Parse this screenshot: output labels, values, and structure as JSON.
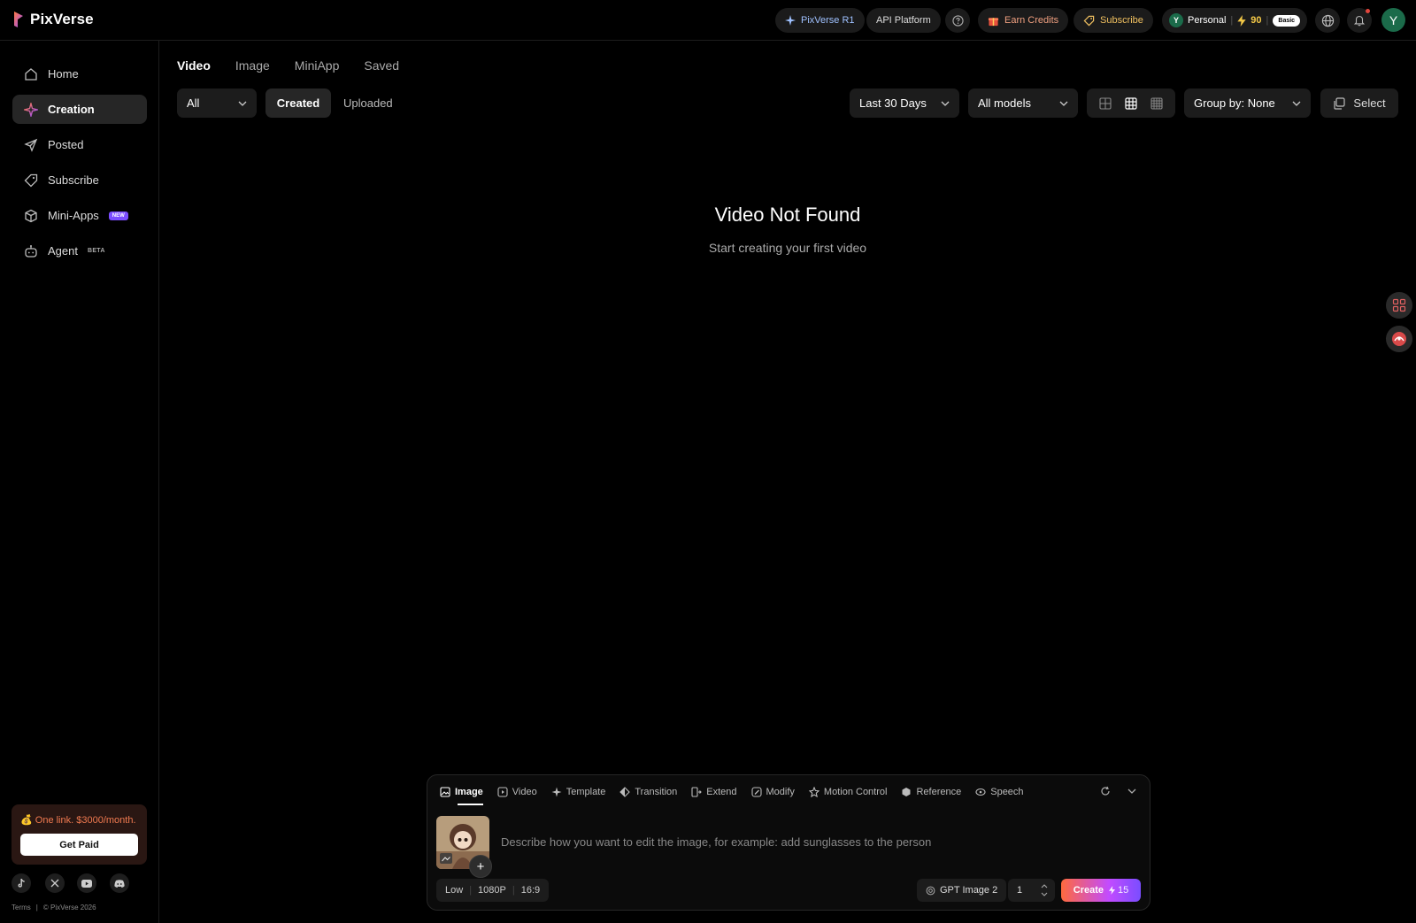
{
  "app": {
    "name": "PixVerse"
  },
  "topbar": {
    "r1_label": "PixVerse R1",
    "api_label": "API Platform",
    "earn_label": "Earn Credits",
    "subscribe_label": "Subscribe",
    "account_initial": "Y",
    "account_label": "Personal",
    "credits": "90",
    "plan": "Basic",
    "avatar_initial": "Y"
  },
  "sidebar": {
    "items": [
      {
        "label": "Home",
        "icon": "home-icon"
      },
      {
        "label": "Creation",
        "icon": "sparkle-icon",
        "active": true
      },
      {
        "label": "Posted",
        "icon": "send-icon"
      },
      {
        "label": "Subscribe",
        "icon": "tag-icon"
      },
      {
        "label": "Mini-Apps",
        "icon": "cube-icon",
        "badge": "NEW"
      },
      {
        "label": "Agent",
        "icon": "robot-icon",
        "badge": "BETA"
      }
    ],
    "promo_text": "One link. $3000/month.",
    "promo_button": "Get Paid",
    "footer_terms": "Terms",
    "footer_copyright": "© PixVerse 2026"
  },
  "content": {
    "tabs": [
      "Video",
      "Image",
      "MiniApp",
      "Saved"
    ],
    "active_tab": "Video",
    "filter_all": "All",
    "created_label": "Created",
    "uploaded_label": "Uploaded",
    "date_range": "Last 30 Days",
    "models": "All models",
    "group_by": "Group by: None",
    "select_label": "Select",
    "empty_title": "Video Not Found",
    "empty_subtitle": "Start creating your first video"
  },
  "composer": {
    "tabs": [
      "Image",
      "Video",
      "Template",
      "Transition",
      "Extend",
      "Modify",
      "Motion Control",
      "Reference",
      "Speech"
    ],
    "active_tab": "Image",
    "placeholder": "Describe how you want to edit the image, for example: add sunglasses to the person",
    "quality": "Low",
    "resolution": "1080P",
    "ratio": "16:9",
    "model": "GPT Image 2",
    "count": "1",
    "create_label": "Create",
    "create_cost": "15"
  },
  "colors": {
    "accent_orange": "#f07a50",
    "credits_yellow": "#f3c847",
    "avatar_green": "#1b6b4a",
    "new_badge": "#7b4dff"
  }
}
